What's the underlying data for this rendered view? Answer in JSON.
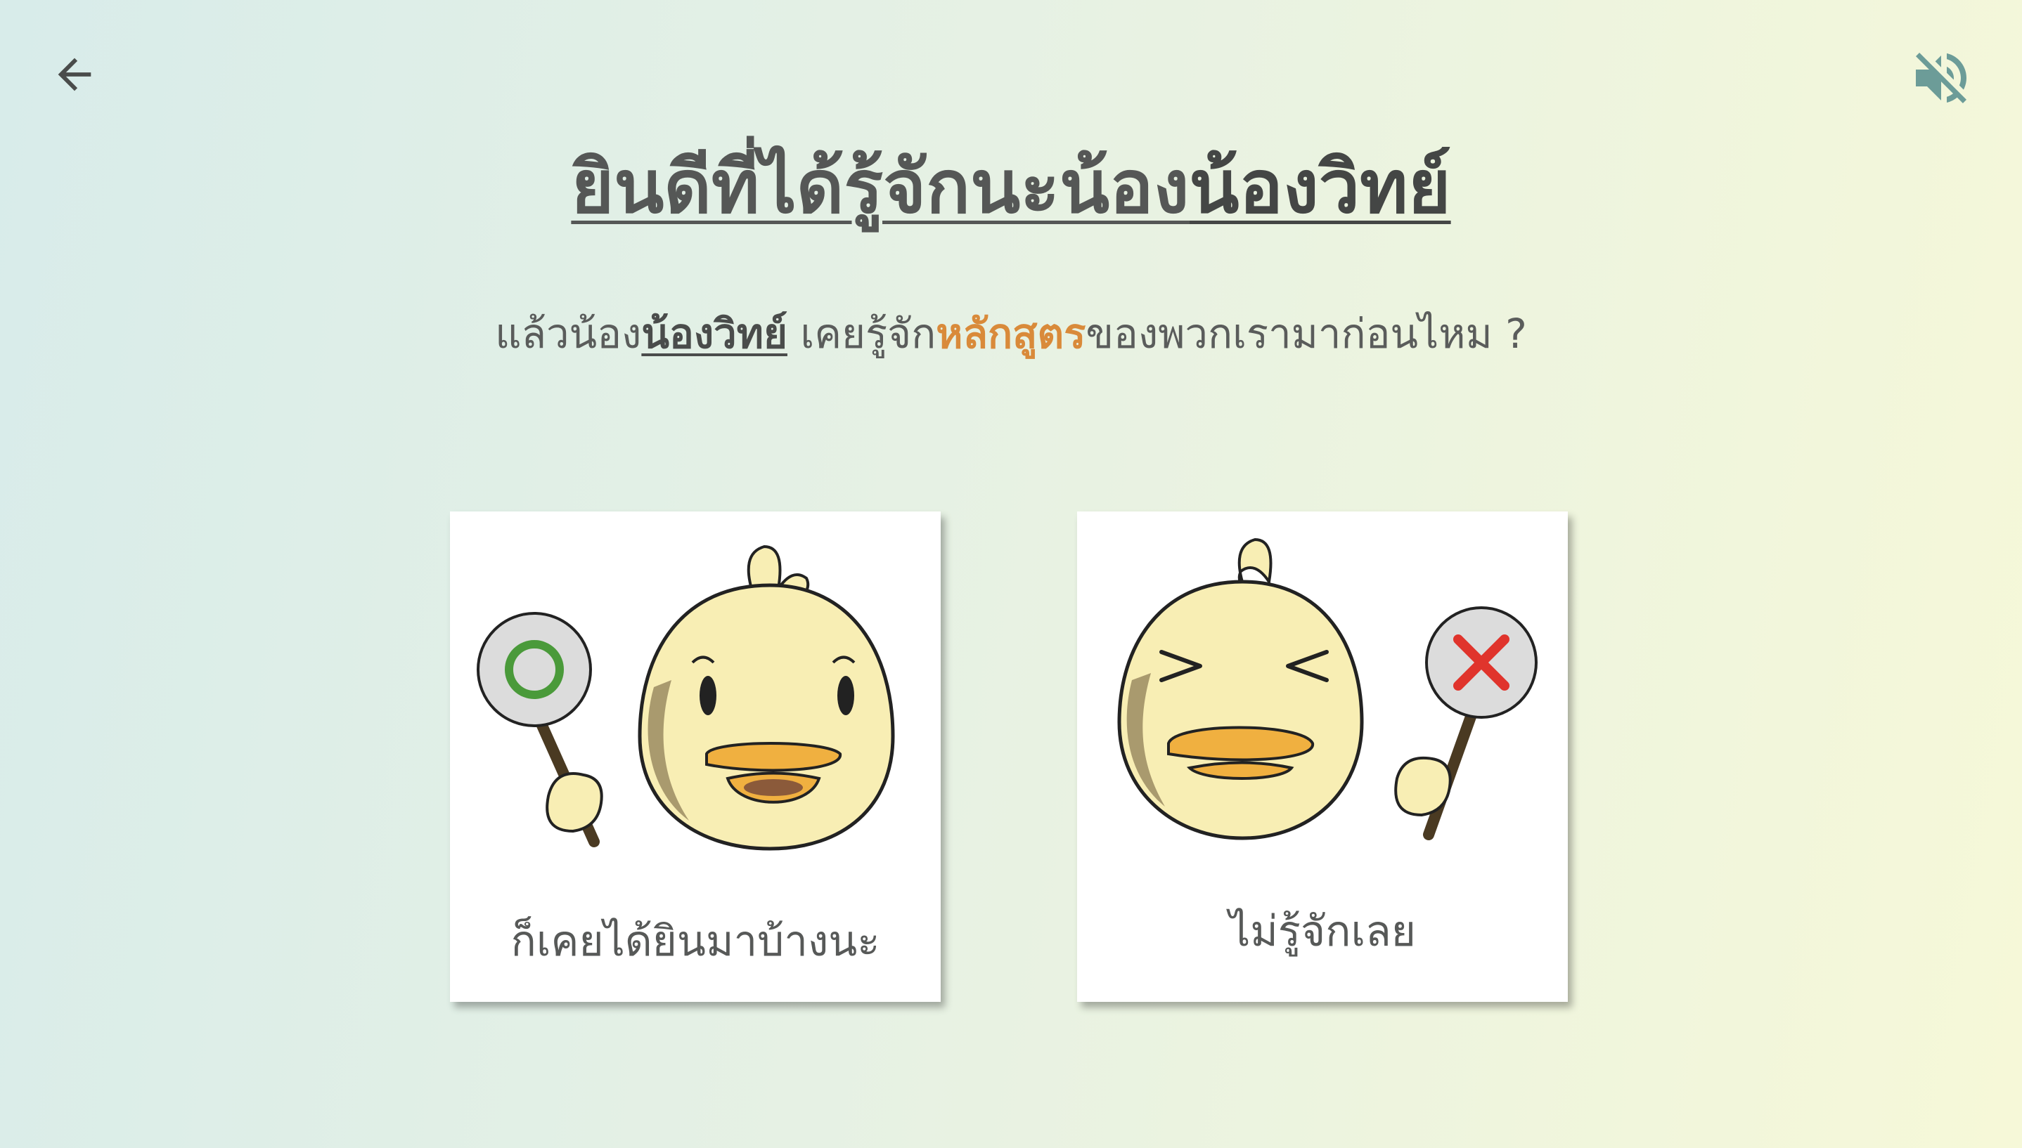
{
  "nav": {
    "back_icon": "arrow-left-icon",
    "sound_icon": "speaker-muted-icon"
  },
  "title": {
    "prefix": "ยินดีที่ได้รู้จักนะน้อง",
    "name": "น้องวิทย์"
  },
  "question": {
    "part1": "แล้วน้อง",
    "name": "น้องวิทย์",
    "part2": " เคยรู้จัก",
    "accent": "หลักสูตร",
    "part3": "ของพวกเรามาก่อนไหม ?"
  },
  "options": [
    {
      "label": "ก็เคยได้ยินมาบ้างนะ",
      "icon": "duck-holding-circle-sign-icon"
    },
    {
      "label": "ไม่รู้จักเลย",
      "icon": "duck-holding-cross-sign-icon"
    }
  ],
  "colors": {
    "accent": "#d98a3a",
    "circle_sign": "#4a9a3a",
    "cross_sign": "#e0342c",
    "duck_body": "#f8eeb4",
    "duck_beak": "#f0b040"
  }
}
